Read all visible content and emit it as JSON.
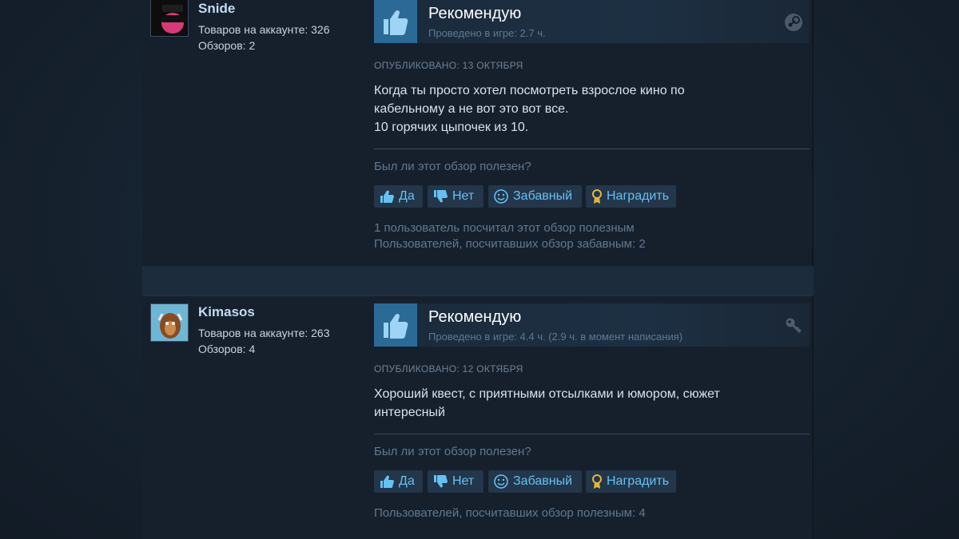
{
  "reviews": [
    {
      "author": {
        "name": "Snide",
        "products_label": "Товаров на аккаунте: 326",
        "reviews_label": "Обзоров: 2"
      },
      "recommendation": "Рекомендую",
      "playtime": "Проведено в игре: 2.7 ч.",
      "source_icon": "steam-icon",
      "posted": "ОПУБЛИКОВАНО: 13 ОКТЯБРЯ",
      "text_lines": [
        "Когда ты просто хотел посмотреть взрослое кино по",
        "кабельному а не вот это вот все.",
        "10 горячих цыпочек из 10."
      ],
      "helpful_question": "Был ли этот обзор полезен?",
      "buttons": {
        "yes": "Да",
        "no": "Нет",
        "funny": "Забавный",
        "award": "Наградить"
      },
      "stats": [
        "1 пользователь посчитал этот обзор полезным",
        "Пользователей, посчитавших обзор забавным: 2"
      ]
    },
    {
      "author": {
        "name": "Kimasos",
        "products_label": "Товаров на аккаунте: 263",
        "reviews_label": "Обзоров: 4"
      },
      "recommendation": "Рекомендую",
      "playtime": "Проведено в игре: 4.4 ч. (2.9 ч. в момент написания)",
      "source_icon": "key-icon",
      "posted": "ОПУБЛИКОВАНО: 12 ОКТЯБРЯ",
      "text_lines": [
        "Хороший квест, с приятными отсылками и юмором, сюжет",
        "интересный"
      ],
      "helpful_question": "Был ли этот обзор полезен?",
      "buttons": {
        "yes": "Да",
        "no": "Нет",
        "funny": "Забавный",
        "award": "Наградить"
      },
      "stats": [
        "Пользователей, посчитавших обзор полезным: 4"
      ]
    }
  ],
  "colors": {
    "accent_link": "#66c0f4",
    "thumb_bg": "#2b6a96",
    "panel_bg": "#16202d",
    "muted_text": "#61788e"
  }
}
